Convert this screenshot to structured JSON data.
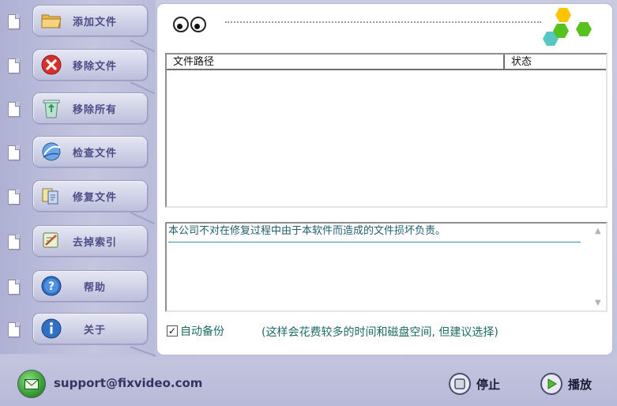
{
  "sidebar": {
    "items": [
      {
        "label": "添加文件",
        "icon": "folder-icon"
      },
      {
        "label": "移除文件",
        "icon": "remove-icon"
      },
      {
        "label": "移除所有",
        "icon": "recycle-bin-icon"
      },
      {
        "label": "检查文件",
        "icon": "check-globe-icon"
      },
      {
        "label": "修复文件",
        "icon": "repair-files-icon"
      },
      {
        "label": "去掉索引",
        "icon": "remove-index-icon"
      },
      {
        "label": "帮助",
        "icon": "help-icon"
      },
      {
        "label": "关于",
        "icon": "info-icon"
      }
    ]
  },
  "table": {
    "columns": [
      "文件路径",
      "状态"
    ],
    "rows": []
  },
  "message": "本公司不对在修复过程中由于本软件而造成的文件损坏负责。",
  "backup": {
    "label": "自动备份",
    "checked": true,
    "note": "(这样会花费较多的时间和磁盘空间, 但建议选择)"
  },
  "footer": {
    "email": "support@fixvideo.com",
    "stop_label": "停止",
    "play_label": "播放"
  },
  "colors": {
    "accent_teal": "#1d6b66",
    "hex_yellow": "#ffc400",
    "hex_green": "#57c21f",
    "hex_teal": "#56c7c6"
  }
}
